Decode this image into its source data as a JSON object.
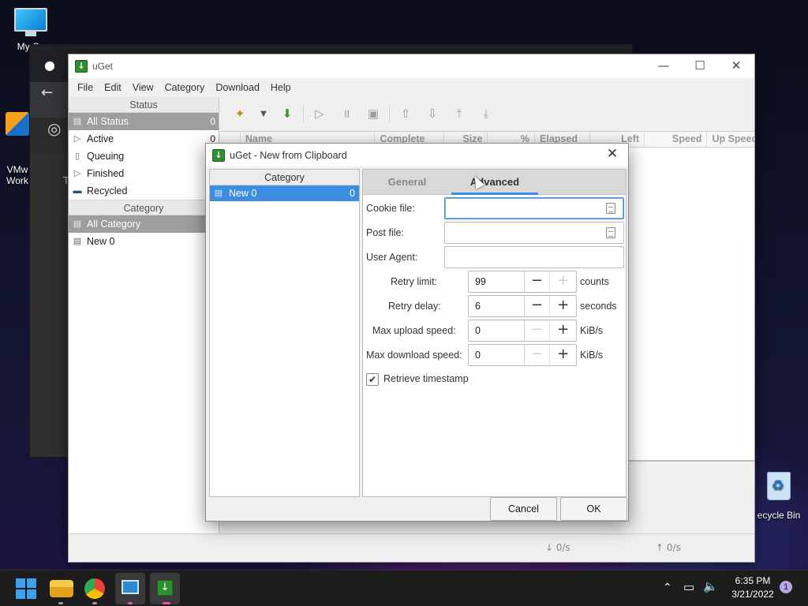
{
  "desktop": {
    "icons": [
      {
        "label": "My Co"
      },
      {
        "label": "VMw\nWork"
      },
      {
        "label": "ecycle Bin"
      }
    ]
  },
  "chrome_bg": {
    "partial_label": "T"
  },
  "uget": {
    "title": "uGet",
    "window_controls": {
      "minimize": "—",
      "maximize": "☐",
      "close": "✕"
    },
    "menu": [
      "File",
      "Edit",
      "View",
      "Category",
      "Download",
      "Help"
    ],
    "status_header": "Status",
    "status_items": [
      {
        "label": "All Status",
        "count": "0",
        "icon": "stack-icon",
        "selected": true
      },
      {
        "label": "Active",
        "count": "0",
        "icon": "play-icon"
      },
      {
        "label": "Queuing",
        "count": "",
        "icon": "doc-icon"
      },
      {
        "label": "Finished",
        "count": "",
        "icon": "finish-icon"
      },
      {
        "label": "Recycled",
        "count": "",
        "icon": "minus-icon"
      }
    ],
    "category_header": "Category",
    "category_items": [
      {
        "label": "All Category",
        "selected": true
      },
      {
        "label": "New 0"
      }
    ],
    "columns": [
      "Name",
      "Complete",
      "Size",
      "%",
      "Elapsed",
      "Left",
      "Speed",
      "Up Speed"
    ],
    "status_bar": {
      "down": "↓ 0/s",
      "up": "↑ 0/s"
    }
  },
  "dialog": {
    "title": "uGet - New from Clipboard",
    "category_header": "Category",
    "category_item": {
      "label": "New 0",
      "count": "0"
    },
    "tabs": [
      {
        "label": "General",
        "active": false
      },
      {
        "label": "Advanced",
        "active": true
      }
    ],
    "fields": {
      "cookie_label": "Cookie file:",
      "cookie_value": "",
      "post_label": "Post file:",
      "post_value": "",
      "agent_label": "User Agent:",
      "agent_value": "",
      "retry_limit_label": "Retry limit:",
      "retry_limit_value": "99",
      "retry_limit_unit": "counts",
      "retry_delay_label": "Retry delay:",
      "retry_delay_value": "6",
      "retry_delay_unit": "seconds",
      "max_up_label": "Max upload speed:",
      "max_up_value": "0",
      "max_up_unit": "KiB/s",
      "max_down_label": "Max download speed:",
      "max_down_value": "0",
      "max_down_unit": "KiB/s",
      "timestamp_label": "Retrieve timestamp",
      "timestamp_checked": true
    },
    "buttons": {
      "cancel": "Cancel",
      "ok": "OK"
    },
    "close_glyph": "✕"
  },
  "taskbar": {
    "time": "6:35 PM",
    "date": "3/21/2022",
    "notification_count": "1"
  },
  "colors": {
    "accent": "#3d8de0",
    "selection_gray": "#9e9e9e",
    "uget_green": "#2f8f2f"
  }
}
